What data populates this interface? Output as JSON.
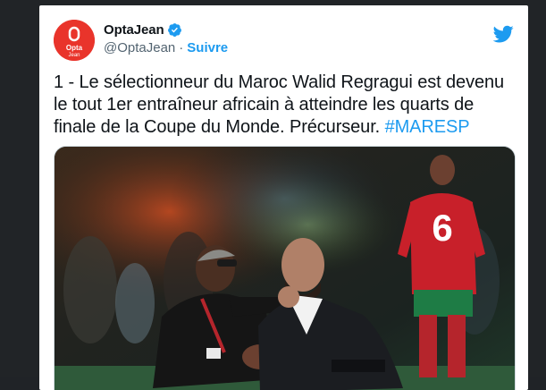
{
  "colors": {
    "accent": "#1d9bf0",
    "text": "#0f1419",
    "secondary": "#536471",
    "avatar_bg": "#e9342b",
    "page_bg": "#212427"
  },
  "tweet": {
    "display_name": "OptaJean",
    "handle": "@OptaJean",
    "separator": "·",
    "follow_label": "Suivre",
    "avatar_text_top": "Opta",
    "avatar_text_bottom": "Jean",
    "text_main": "1 - Le sélectionneur du Maroc Walid Regragui est devenu le tout 1er entraîneur africain à atteindre les quarts de finale de la Coupe du Monde. Précurseur. ",
    "hashtag": "#MARESP",
    "media_alt": "Walid Regragui et un membre du staff marocain accroupis sur la pelouse",
    "jersey_number": "6"
  },
  "icons": {
    "verified": "verified-badge-icon",
    "platform": "twitter-bird-icon"
  }
}
